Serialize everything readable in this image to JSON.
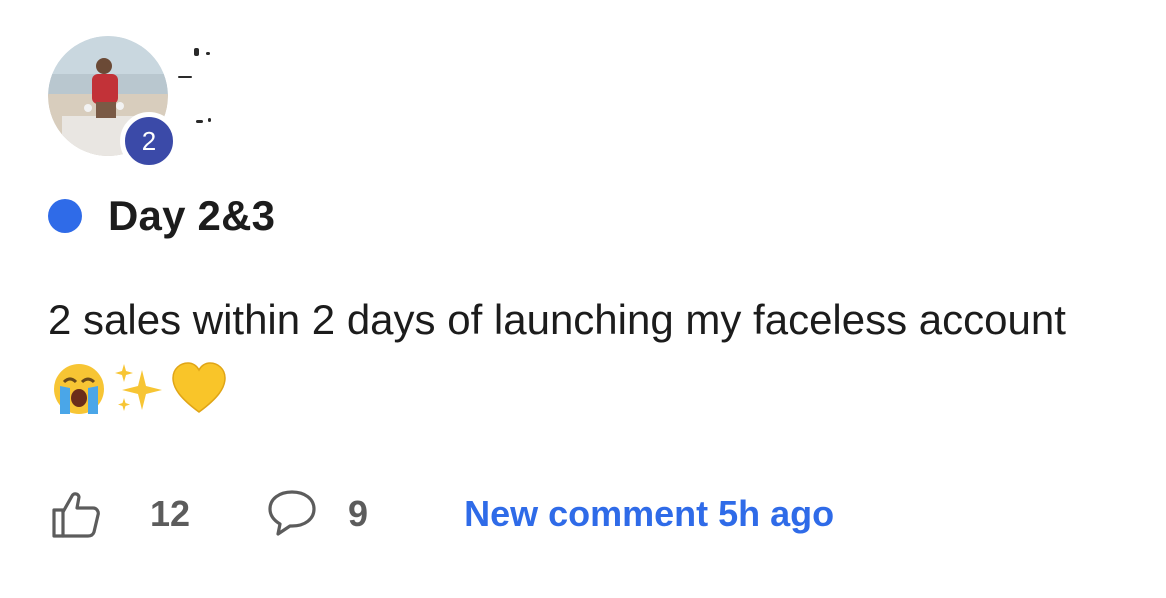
{
  "author": {
    "level": "2"
  },
  "post": {
    "title": "Day 2&3",
    "body": "2 sales within 2 days of launching my faceless account",
    "emojis": [
      "crying-face-emoji",
      "sparkles-emoji",
      "yellow-heart-emoji"
    ]
  },
  "actions": {
    "like_count": "12",
    "comment_count": "9",
    "new_comment_label": "New comment 5h ago"
  },
  "colors": {
    "accent": "#2f6be8",
    "level_badge": "#3b4aa8",
    "text": "#1c1c1c",
    "muted": "#5c5c5c"
  }
}
